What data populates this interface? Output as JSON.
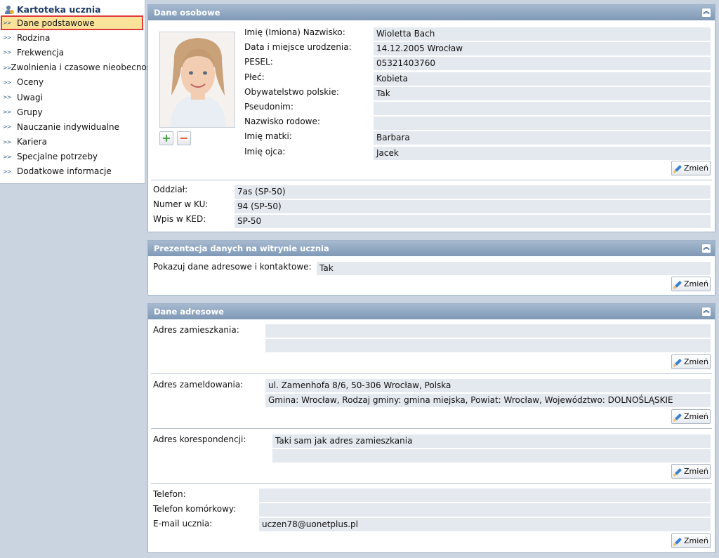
{
  "sidebar": {
    "title": "Kartoteka ucznia",
    "items": [
      {
        "label": "Dane podstawowe"
      },
      {
        "label": "Rodzina"
      },
      {
        "label": "Frekwencja"
      },
      {
        "label": "Zwolnienia i czasowe nieobecności"
      },
      {
        "label": "Oceny"
      },
      {
        "label": "Uwagi"
      },
      {
        "label": "Grupy"
      },
      {
        "label": "Nauczanie indywidualne"
      },
      {
        "label": "Kariera"
      },
      {
        "label": "Specjalne potrzeby"
      },
      {
        "label": "Dodatkowe informacje"
      }
    ]
  },
  "personal": {
    "title": "Dane osobowe",
    "fields": [
      {
        "label": "Imię (Imiona) Nazwisko:",
        "value": "Wioletta Bach"
      },
      {
        "label": "Data i miejsce urodzenia:",
        "value": "14.12.2005 Wrocław"
      },
      {
        "label": "PESEL:",
        "value": "05321403760"
      },
      {
        "label": "Płeć:",
        "value": "Kobieta"
      },
      {
        "label": "Obywatelstwo polskie:",
        "value": "Tak"
      },
      {
        "label": "Pseudonim:",
        "value": ""
      },
      {
        "label": "Nazwisko rodowe:",
        "value": ""
      },
      {
        "label": "Imię matki:",
        "value": "Barbara"
      },
      {
        "label": "Imię ojca:",
        "value": "Jacek"
      }
    ],
    "class_fields": [
      {
        "label": "Oddział:",
        "value": "7as (SP-50)"
      },
      {
        "label": "Numer w KU:",
        "value": "94 (SP-50)"
      },
      {
        "label": "Wpis w KED:",
        "value": "SP-50"
      }
    ]
  },
  "presentation": {
    "title": "Prezentacja danych na witrynie ucznia",
    "label": "Pokazuj dane adresowe i kontaktowe:",
    "value": "Tak"
  },
  "address": {
    "title": "Dane adresowe",
    "residence_label": "Adres zamieszkania:",
    "residence_line1": "",
    "residence_line2": "",
    "registered_label": "Adres zameldowania:",
    "registered_line1": "ul. Zamenhofa 8/6, 50-306 Wrocław, Polska",
    "registered_line2": "Gmina: Wrocław, Rodzaj gminy: gmina miejska, Powiat: Wrocław, Województwo: DOLNOŚLĄSKIE",
    "correspondence_label": "Adres korespondencji:",
    "correspondence_line1": "Taki sam jak adres zamieszkania",
    "correspondence_line2": "",
    "phone_label": "Telefon:",
    "phone_value": "",
    "mobile_label": "Telefon komórkowy:",
    "mobile_value": "",
    "email_label": "E-mail ucznia:",
    "email_value": "uczen78@uonetplus.pl"
  },
  "buttons": {
    "edit_label": "Zmień"
  },
  "icons": {
    "collapse": "double-chevron-up-icon",
    "add": "plus-icon",
    "remove": "minus-icon",
    "edit": "pencil-icon",
    "student": "student-icon"
  },
  "colors": {
    "header": "#8aa3bf",
    "active_item": "#fbe49a",
    "active_border": "#e03b3b",
    "field_bg": "#e4e9ef"
  }
}
